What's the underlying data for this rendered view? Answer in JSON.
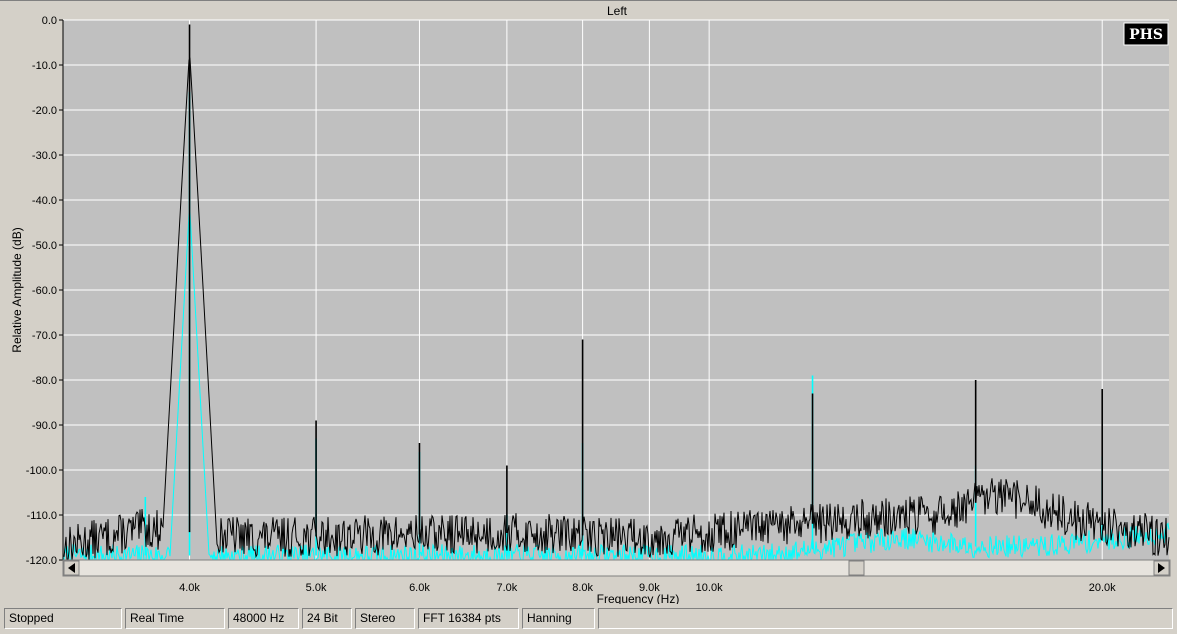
{
  "window": {
    "channel_title": "Left",
    "badge": "PHS"
  },
  "status_bar": [
    "Stopped",
    "Real Time",
    "48000 Hz",
    "24 Bit",
    "Stereo",
    "FFT 16384 pts",
    "Hanning",
    ""
  ],
  "colors": {
    "plot_background": "#c0c0c0",
    "grid": "#ffffff",
    "primary_trace": "#000000",
    "secondary_trace": "#00ffff",
    "window_face": "#d4d0c8"
  },
  "chart_data": {
    "type": "line",
    "title": "Left",
    "xlabel": "Frequency (Hz)",
    "ylabel": "Relative Amplitude (dB)",
    "x_scale": "log",
    "xlim": [
      3200,
      22500
    ],
    "ylim": [
      -120,
      0
    ],
    "grid": true,
    "y_ticks": [
      0,
      -10,
      -20,
      -30,
      -40,
      -50,
      -60,
      -70,
      -80,
      -90,
      -100,
      -110,
      -120
    ],
    "y_tick_labels": [
      "0.0",
      "-10.0",
      "-20.0",
      "-30.0",
      "-40.0",
      "-50.0",
      "-60.0",
      "-70.0",
      "-80.0",
      "-90.0",
      "-100.0",
      "-110.0",
      "-120.0"
    ],
    "x_ticks": [
      4000,
      5000,
      6000,
      7000,
      8000,
      9000,
      10000,
      20000
    ],
    "x_tick_labels": [
      "4.0k",
      "5.0k",
      "6.0k",
      "7.0k",
      "8.0k",
      "9.0k",
      "10.0k",
      "20.0k"
    ],
    "series": [
      {
        "color": "#000000",
        "peaks": [
          {
            "x": 4000,
            "y": -1
          },
          {
            "x": 5000,
            "y": -89
          },
          {
            "x": 6000,
            "y": -94
          },
          {
            "x": 7000,
            "y": -99
          },
          {
            "x": 8000,
            "y": -71
          },
          {
            "x": 12000,
            "y": -83
          },
          {
            "x": 16000,
            "y": -80
          },
          {
            "x": 20000,
            "y": -82
          }
        ],
        "noise_floor": [
          {
            "x": 3200,
            "y": -117
          },
          {
            "x": 3700,
            "y": -113
          },
          {
            "x": 4500,
            "y": -115
          },
          {
            "x": 7000,
            "y": -114
          },
          {
            "x": 9000,
            "y": -115
          },
          {
            "x": 11000,
            "y": -113
          },
          {
            "x": 13000,
            "y": -111
          },
          {
            "x": 15000,
            "y": -110
          },
          {
            "x": 16500,
            "y": -106
          },
          {
            "x": 17500,
            "y": -107
          },
          {
            "x": 19000,
            "y": -111
          },
          {
            "x": 22500,
            "y": -115
          }
        ]
      },
      {
        "color": "#00ffff",
        "peaks": [
          {
            "x": 3700,
            "y": -106
          },
          {
            "x": 4000,
            "y": -16
          },
          {
            "x": 5000,
            "y": -93
          },
          {
            "x": 6000,
            "y": -96
          },
          {
            "x": 7000,
            "y": -110
          },
          {
            "x": 8000,
            "y": -94
          },
          {
            "x": 12000,
            "y": -79
          },
          {
            "x": 16000,
            "y": -99
          },
          {
            "x": 20000,
            "y": -97
          }
        ],
        "noise_floor": [
          {
            "x": 3200,
            "y": -119
          },
          {
            "x": 4500,
            "y": -119
          },
          {
            "x": 11000,
            "y": -119
          },
          {
            "x": 12500,
            "y": -117
          },
          {
            "x": 14000,
            "y": -115
          },
          {
            "x": 16000,
            "y": -117
          },
          {
            "x": 18000,
            "y": -117
          },
          {
            "x": 22500,
            "y": -114
          }
        ]
      }
    ]
  }
}
